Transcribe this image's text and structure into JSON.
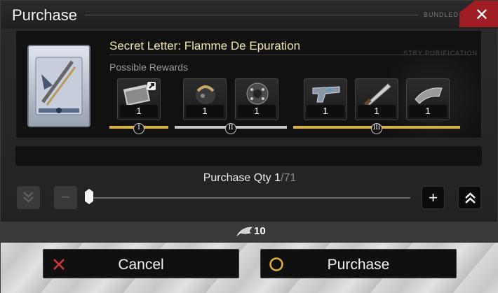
{
  "dialog": {
    "title": "Purchase",
    "header_tag": "BUNDLED"
  },
  "item": {
    "name": "Secret Letter: Flamme De Epuration",
    "watermark": "STRY PURIFICATION",
    "rewards_label": "Possible Rewards",
    "tiers": [
      {
        "badge": "I",
        "color": "#d8b24a",
        "rewards": [
          {
            "icon": "letter-and-hammer-icon",
            "qty": "1"
          }
        ]
      },
      {
        "badge": "II",
        "color": "#c9c9c9",
        "rewards": [
          {
            "icon": "helmet-icon",
            "qty": "1"
          },
          {
            "icon": "orb-icon",
            "qty": "1"
          }
        ]
      },
      {
        "badge": "III",
        "color": "#d8b24a",
        "rewards": [
          {
            "icon": "pistol-icon",
            "qty": "1"
          },
          {
            "icon": "blade-icon",
            "qty": "1"
          },
          {
            "icon": "cloth-icon",
            "qty": "1"
          }
        ]
      }
    ]
  },
  "quantity": {
    "label": "Purchase Qty",
    "current": "1",
    "max": "71",
    "level": 0.0
  },
  "cost": {
    "icon": "feather-currency-icon",
    "amount": "10"
  },
  "buttons": {
    "cancel": "Cancel",
    "purchase": "Purchase"
  },
  "colors": {
    "close_red": "#a11d24",
    "gold": "#d8b24a",
    "silver": "#c9c9c9",
    "item_name": "#efe6b0"
  }
}
